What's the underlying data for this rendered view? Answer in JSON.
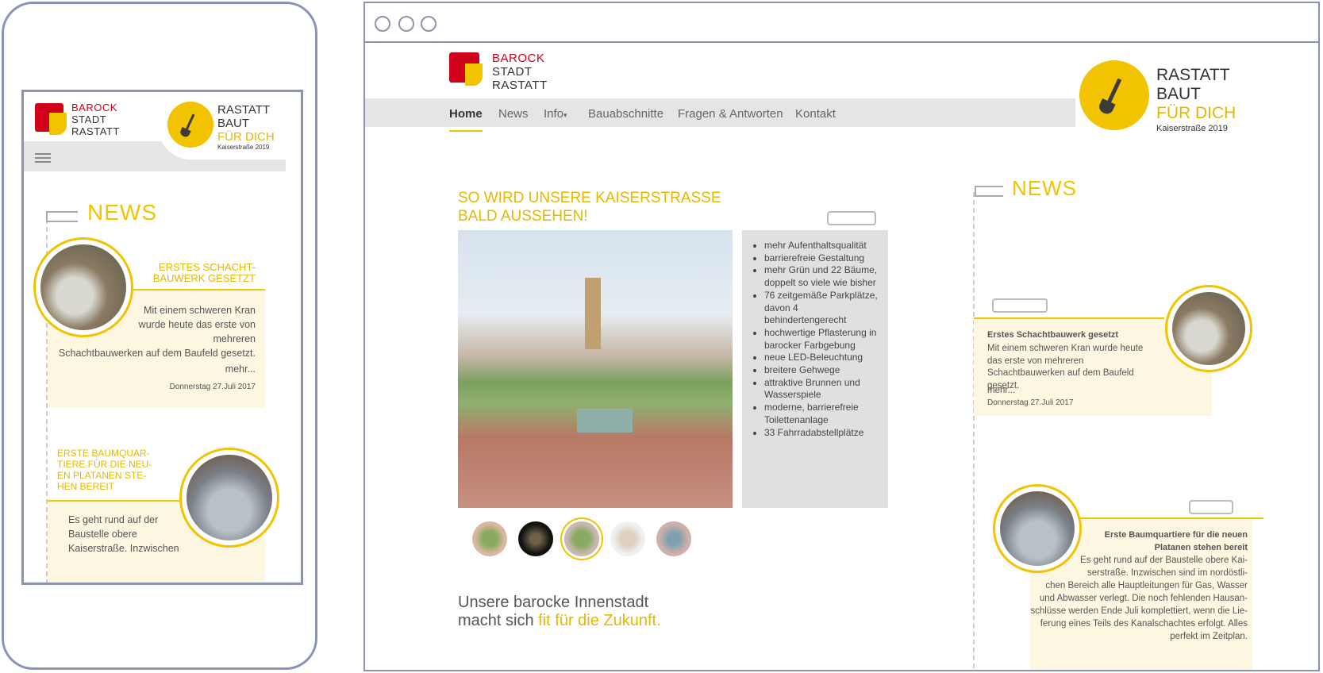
{
  "logo": {
    "barock": "BAROCK",
    "stadt": "STADT",
    "rastatt": "RASTATT"
  },
  "campaign": {
    "line1": "RASTATT",
    "line2": "BAUT",
    "line3": "FÜR DICH",
    "sub": "Kaiserstraße 2019"
  },
  "nav": {
    "home": "Home",
    "news": "News",
    "info": "Info",
    "info_caret": "▾",
    "bau": "Bauabschnitte",
    "faq": "Fragen & Antworten",
    "kontakt": "Kontakt"
  },
  "hero": {
    "title1": "SO WIRD UNSERE KAISERSTRASSE",
    "title2": "BALD AUSSEHEN!",
    "features": [
      "mehr Aufenthaltsqualität",
      "barrierefreie Gestaltung",
      "mehr Grün und 22 Bäume, doppelt so viele wie bisher",
      "76 zeitgemäße Parkplätze, davon 4 behindertengerecht",
      "hochwertige Pflasterung in barocker Farbgebung",
      "neue LED-Beleuchtung",
      "breitere Gehwege",
      "attraktive Brunnen und Wasserspiele",
      "moderne, barrierefreie Toilettenanlage",
      "33 Fahrradabstellplätze"
    ]
  },
  "tagline": {
    "line1": "Unsere barocke Innenstadt",
    "line2a": "macht sich ",
    "line2b": "fit für die Zukunft."
  },
  "news": {
    "heading": "NEWS",
    "desktop": [
      {
        "title": "Erstes Schachtbauwerk gesetzt",
        "text": "Mit einem schweren Kran wurde heute das erste von mehreren Schachtbauwerken auf dem Baufeld gesetzt.",
        "more": "mehr...",
        "date": "Donnerstag 27.Juli 2017"
      },
      {
        "title1": "Erste Baumquartiere für die neuen",
        "title2": "Platanen stehen bereit",
        "lines": [
          "Es geht rund auf der Baustelle obere Kai-",
          "serstraße. Inzwischen sind im nordöstli-",
          "chen Bereich alle Hauptleitungen für Gas, Wasser",
          "und Abwasser verlegt. Die noch fehlenden Hausan-",
          "schlüsse werden Ende Juli komplettiert, wenn die Lie-",
          "ferung eines Teils des Kanalschachtes erfolgt. Alles",
          "perfekt im Zeitplan."
        ]
      }
    ],
    "mobile": [
      {
        "title1": "ERSTES SCHACHT-",
        "title2": "BAUWERK GESETZT",
        "lines": [
          "Mit einem schweren Kran",
          "wurde heute das erste von",
          "mehreren",
          "Schachtbauwerken auf dem Baufeld gesetzt."
        ],
        "more": "mehr...",
        "date": "Donnerstag 27.Juli 2017"
      },
      {
        "title_lines": [
          "ERSTE BAUMQUAR-",
          "TIERE FÜR DIE NEU-",
          "EN PLATANEN STE-",
          "HEN BEREIT"
        ],
        "lines": [
          "Es geht rund auf der",
          "Baustelle obere",
          "Kaiserstraße. Inzwischen"
        ]
      }
    ]
  },
  "colors": {
    "accent": "#f2c300",
    "frame": "#8b93b5",
    "brand_red": "#d0021b"
  }
}
